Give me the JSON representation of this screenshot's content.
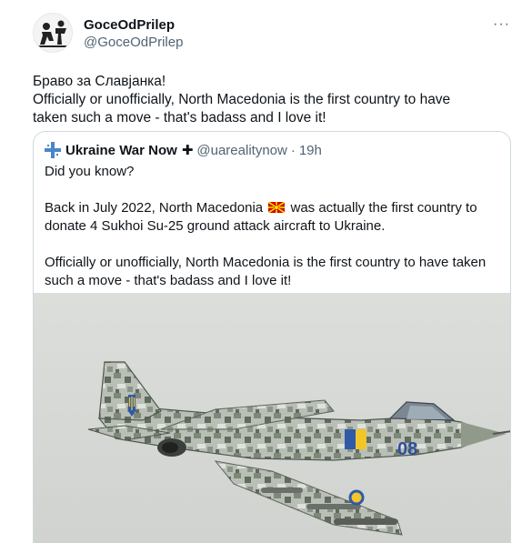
{
  "author": {
    "display_name": "GoceOdPrilep",
    "handle": "@GoceOdPrilep",
    "avatar_icon": "avatar-silhouette-icon",
    "more_label": "···"
  },
  "tweet": {
    "lines": [
      "Браво за Славјанка!",
      "Officially or unofficially, North Macedonia is the first country to have",
      "taken such a move - that's badass and I love it!"
    ]
  },
  "quote": {
    "display_name": "Ukraine War Now",
    "plus": "✚",
    "handle": "@uarealitynow",
    "dot": "·",
    "time": "19h",
    "logo_icon": "blue-cross-logo-icon",
    "line1": "Did you know?",
    "line2_before_flag": "Back in July 2022, North Macedonia",
    "flag_icon": "north-macedonia-flag-icon",
    "line2_after_flag": "was actually the first country to",
    "line3": "donate 4 Sukhoi Su-25 ground attack aircraft to Ukraine.",
    "line4": "Officially or unofficially, North Macedonia is the first country to have taken",
    "line5": "such a move - that's badass and I love it!"
  },
  "media": {
    "tail_number": "08",
    "colors": {
      "sky": "#d8dad6",
      "camo_light": "#b9bfb7",
      "camo_dark": "#6f7a6c",
      "flag_blue": "#2e5aa8",
      "flag_yellow": "#f2c52b"
    }
  },
  "colors": {
    "text": "#0f1419",
    "secondary": "#536471",
    "border": "#cfd9de",
    "link_blue": "#1d9bf0"
  }
}
